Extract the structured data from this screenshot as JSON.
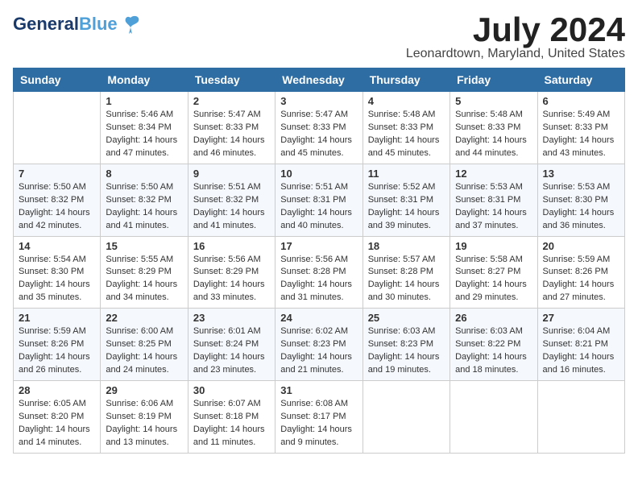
{
  "logo": {
    "line1": "General",
    "line2": "Blue"
  },
  "title": "July 2024",
  "location": "Leonardtown, Maryland, United States",
  "days_of_week": [
    "Sunday",
    "Monday",
    "Tuesday",
    "Wednesday",
    "Thursday",
    "Friday",
    "Saturday"
  ],
  "weeks": [
    [
      {
        "day": "",
        "info": ""
      },
      {
        "day": "1",
        "info": "Sunrise: 5:46 AM\nSunset: 8:34 PM\nDaylight: 14 hours\nand 47 minutes."
      },
      {
        "day": "2",
        "info": "Sunrise: 5:47 AM\nSunset: 8:33 PM\nDaylight: 14 hours\nand 46 minutes."
      },
      {
        "day": "3",
        "info": "Sunrise: 5:47 AM\nSunset: 8:33 PM\nDaylight: 14 hours\nand 45 minutes."
      },
      {
        "day": "4",
        "info": "Sunrise: 5:48 AM\nSunset: 8:33 PM\nDaylight: 14 hours\nand 45 minutes."
      },
      {
        "day": "5",
        "info": "Sunrise: 5:48 AM\nSunset: 8:33 PM\nDaylight: 14 hours\nand 44 minutes."
      },
      {
        "day": "6",
        "info": "Sunrise: 5:49 AM\nSunset: 8:33 PM\nDaylight: 14 hours\nand 43 minutes."
      }
    ],
    [
      {
        "day": "7",
        "info": "Sunrise: 5:50 AM\nSunset: 8:32 PM\nDaylight: 14 hours\nand 42 minutes."
      },
      {
        "day": "8",
        "info": "Sunrise: 5:50 AM\nSunset: 8:32 PM\nDaylight: 14 hours\nand 41 minutes."
      },
      {
        "day": "9",
        "info": "Sunrise: 5:51 AM\nSunset: 8:32 PM\nDaylight: 14 hours\nand 41 minutes."
      },
      {
        "day": "10",
        "info": "Sunrise: 5:51 AM\nSunset: 8:31 PM\nDaylight: 14 hours\nand 40 minutes."
      },
      {
        "day": "11",
        "info": "Sunrise: 5:52 AM\nSunset: 8:31 PM\nDaylight: 14 hours\nand 39 minutes."
      },
      {
        "day": "12",
        "info": "Sunrise: 5:53 AM\nSunset: 8:31 PM\nDaylight: 14 hours\nand 37 minutes."
      },
      {
        "day": "13",
        "info": "Sunrise: 5:53 AM\nSunset: 8:30 PM\nDaylight: 14 hours\nand 36 minutes."
      }
    ],
    [
      {
        "day": "14",
        "info": "Sunrise: 5:54 AM\nSunset: 8:30 PM\nDaylight: 14 hours\nand 35 minutes."
      },
      {
        "day": "15",
        "info": "Sunrise: 5:55 AM\nSunset: 8:29 PM\nDaylight: 14 hours\nand 34 minutes."
      },
      {
        "day": "16",
        "info": "Sunrise: 5:56 AM\nSunset: 8:29 PM\nDaylight: 14 hours\nand 33 minutes."
      },
      {
        "day": "17",
        "info": "Sunrise: 5:56 AM\nSunset: 8:28 PM\nDaylight: 14 hours\nand 31 minutes."
      },
      {
        "day": "18",
        "info": "Sunrise: 5:57 AM\nSunset: 8:28 PM\nDaylight: 14 hours\nand 30 minutes."
      },
      {
        "day": "19",
        "info": "Sunrise: 5:58 AM\nSunset: 8:27 PM\nDaylight: 14 hours\nand 29 minutes."
      },
      {
        "day": "20",
        "info": "Sunrise: 5:59 AM\nSunset: 8:26 PM\nDaylight: 14 hours\nand 27 minutes."
      }
    ],
    [
      {
        "day": "21",
        "info": "Sunrise: 5:59 AM\nSunset: 8:26 PM\nDaylight: 14 hours\nand 26 minutes."
      },
      {
        "day": "22",
        "info": "Sunrise: 6:00 AM\nSunset: 8:25 PM\nDaylight: 14 hours\nand 24 minutes."
      },
      {
        "day": "23",
        "info": "Sunrise: 6:01 AM\nSunset: 8:24 PM\nDaylight: 14 hours\nand 23 minutes."
      },
      {
        "day": "24",
        "info": "Sunrise: 6:02 AM\nSunset: 8:23 PM\nDaylight: 14 hours\nand 21 minutes."
      },
      {
        "day": "25",
        "info": "Sunrise: 6:03 AM\nSunset: 8:23 PM\nDaylight: 14 hours\nand 19 minutes."
      },
      {
        "day": "26",
        "info": "Sunrise: 6:03 AM\nSunset: 8:22 PM\nDaylight: 14 hours\nand 18 minutes."
      },
      {
        "day": "27",
        "info": "Sunrise: 6:04 AM\nSunset: 8:21 PM\nDaylight: 14 hours\nand 16 minutes."
      }
    ],
    [
      {
        "day": "28",
        "info": "Sunrise: 6:05 AM\nSunset: 8:20 PM\nDaylight: 14 hours\nand 14 minutes."
      },
      {
        "day": "29",
        "info": "Sunrise: 6:06 AM\nSunset: 8:19 PM\nDaylight: 14 hours\nand 13 minutes."
      },
      {
        "day": "30",
        "info": "Sunrise: 6:07 AM\nSunset: 8:18 PM\nDaylight: 14 hours\nand 11 minutes."
      },
      {
        "day": "31",
        "info": "Sunrise: 6:08 AM\nSunset: 8:17 PM\nDaylight: 14 hours\nand 9 minutes."
      },
      {
        "day": "",
        "info": ""
      },
      {
        "day": "",
        "info": ""
      },
      {
        "day": "",
        "info": ""
      }
    ]
  ]
}
